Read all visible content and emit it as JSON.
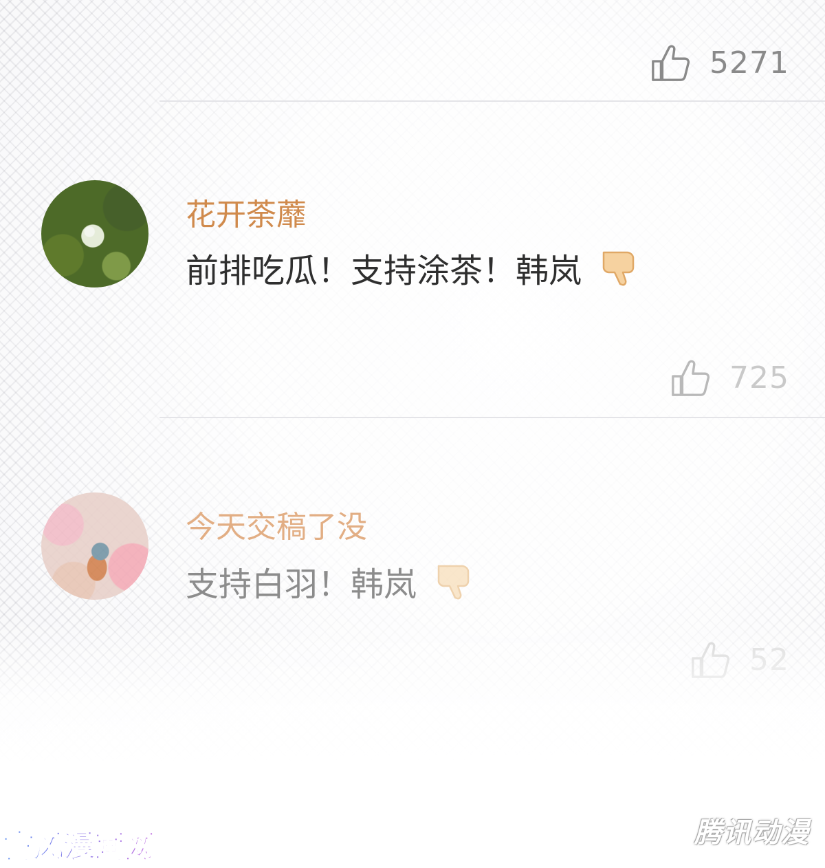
{
  "top_like": {
    "count": "5271",
    "icon": "thumbs-up-icon"
  },
  "comments": [
    {
      "username": "花开荼蘼",
      "text": "前排吃瓜！支持涂茶！韩岚",
      "reaction_icon": "thumbs-down-icon",
      "likes": "725",
      "avatar": "lotus-avatar"
    },
    {
      "username": "今天交稿了没",
      "text": "支持白羽！韩岚",
      "reaction_icon": "thumbs-down-icon",
      "likes": "52",
      "avatar": "bird-avatar"
    }
  ],
  "watermarks": {
    "left": "古风漫画网",
    "right": "腾讯动漫"
  },
  "colors": {
    "username": "#d08a4c",
    "reaction": "#f0c58e",
    "like_icon": "#8a8a8a"
  }
}
